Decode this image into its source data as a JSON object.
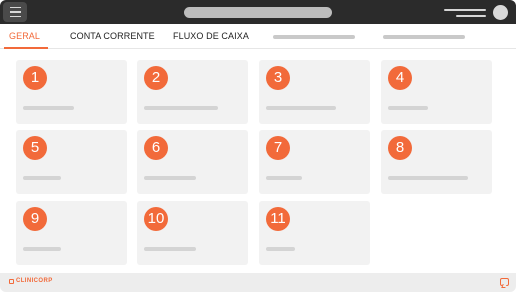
{
  "tabs": [
    {
      "label": "GERAL",
      "active": true
    },
    {
      "label": "CONTA CORRENTE",
      "active": false
    },
    {
      "label": "FLUXO DE CAIXA",
      "active": false
    }
  ],
  "cards": [
    {
      "number": "1"
    },
    {
      "number": "2"
    },
    {
      "number": "3"
    },
    {
      "number": "4"
    },
    {
      "number": "5"
    },
    {
      "number": "6"
    },
    {
      "number": "7"
    },
    {
      "number": "8"
    },
    {
      "number": "9"
    },
    {
      "number": "10"
    },
    {
      "number": "11"
    }
  ],
  "footer": {
    "brand": "CLINICORP"
  },
  "colors": {
    "accent": "#f26a3a",
    "topbar": "#2b2b2b",
    "card": "#f2f2f2",
    "placeholder": "#d4d4d4"
  },
  "icons": {
    "menu": "hamburger-menu-icon",
    "avatar": "user-avatar-icon",
    "chat": "chat-bubble-icon",
    "logo": "clinicorp-logo-icon"
  }
}
